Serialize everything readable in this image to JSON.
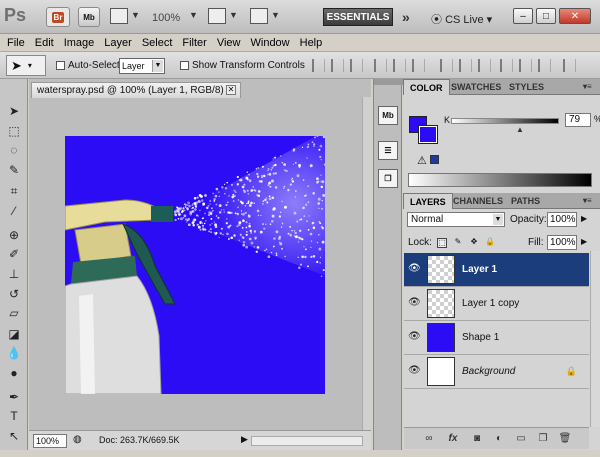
{
  "appbar": {
    "logo": "Ps",
    "bridge_label": "Br",
    "minibridge_label": "Mb",
    "zoom": "100%",
    "workspace": "ESSENTIALS",
    "more": "»",
    "cs_live": "CS Live",
    "win_minimize": "–",
    "win_restore": "□",
    "win_close": "✕"
  },
  "menu": {
    "items": [
      "File",
      "Edit",
      "Image",
      "Layer",
      "Select",
      "Filter",
      "View",
      "Window",
      "Help"
    ]
  },
  "options": {
    "auto_select_label": "Auto-Select:",
    "auto_select_value": "Layer",
    "transform_label": "Show Transform Controls"
  },
  "toolbox": {
    "tools": [
      "move-tool",
      "marquee-tool",
      "lasso-tool",
      "quick-select-tool",
      "crop-tool",
      "eyedropper-tool",
      "healing-brush-tool",
      "brush-tool",
      "clone-stamp-tool",
      "history-brush-tool",
      "eraser-tool",
      "paint-bucket-tool",
      "blur-tool",
      "dodge-tool",
      "pen-tool",
      "type-tool",
      "path-select-tool"
    ]
  },
  "document": {
    "tab_title": "waterspray.psd @ 100% (Layer 1, RGB/8)",
    "tab_close": "✕",
    "zoom": "100%",
    "doc_info": "Doc: 263.7K/669.5K"
  },
  "iconstrip": {
    "minibridge": "Mb"
  },
  "color_panel": {
    "tabs": [
      "COLOR",
      "SWATCHES",
      "STYLES"
    ],
    "channel_label": "K",
    "channel_value": "79",
    "channel_unit": "%",
    "fg_color": "#2b0cf5",
    "bg_color": "#2b0cf5"
  },
  "layers_panel": {
    "tabs": [
      "LAYERS",
      "CHANNELS",
      "PATHS"
    ],
    "blend_mode": "Normal",
    "opacity_label": "Opacity:",
    "opacity_value": "100%",
    "lock_label": "Lock:",
    "fill_label": "Fill:",
    "fill_value": "100%",
    "layers": [
      {
        "name": "Layer 1",
        "selected": true
      },
      {
        "name": "Layer 1 copy",
        "selected": false
      },
      {
        "name": "Shape 1",
        "selected": false
      },
      {
        "name": "Background",
        "selected": false
      }
    ]
  }
}
